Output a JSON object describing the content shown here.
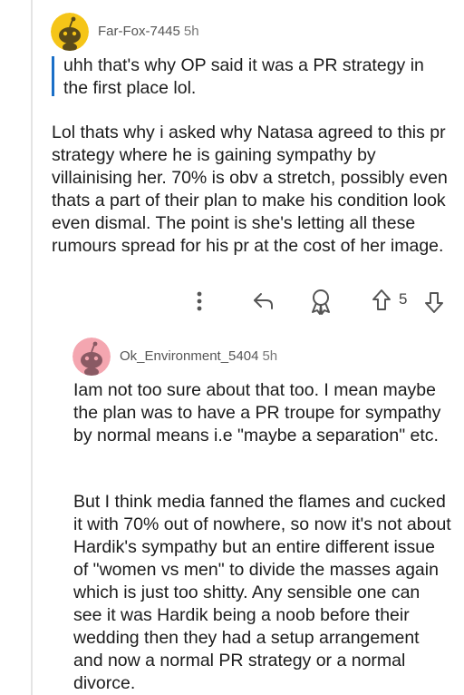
{
  "comment1": {
    "username": "Far-Fox-7445",
    "time": "5h",
    "quote": "uhh that's why OP said it was a PR strategy in the first place lol.",
    "body": "Lol thats why i asked why Natasa agreed to this pr strategy where he is gaining sympathy by villainising her. 70% is obv a stretch, possibly even thats a part of their plan to make his condition look even dismal. The point is she's letting all these rumours spread for his pr at the cost of her image.",
    "vote_count": "5"
  },
  "comment2": {
    "username": "Ok_Environment_5404",
    "time": "5h",
    "paragraph1": "Iam not too sure about that too. I mean maybe the plan was to have a PR troupe for sympathy by normal means i.e \"maybe a separation\" etc.",
    "paragraph2": "But I think media fanned the flames and cucked it with 70% out of nowhere, so now it's not about Hardik's sympathy but an entire different issue of \"women vs men\" to divide the masses again which is just too shitty. Any sensible one can see it was Hardik being a noob before their wedding then they had a setup arrangement and now a normal PR strategy or a normal divorce."
  },
  "icons": {
    "more": "more-vertical-icon",
    "reply": "reply-arrow-icon",
    "award": "award-icon",
    "upvote": "upvote-arrow-icon",
    "downvote": "downvote-arrow-icon"
  },
  "colors": {
    "quote_bar": "#1a6fc7",
    "avatar1_bg": "#f5c518",
    "avatar2_bg": "#f4a6b0"
  }
}
